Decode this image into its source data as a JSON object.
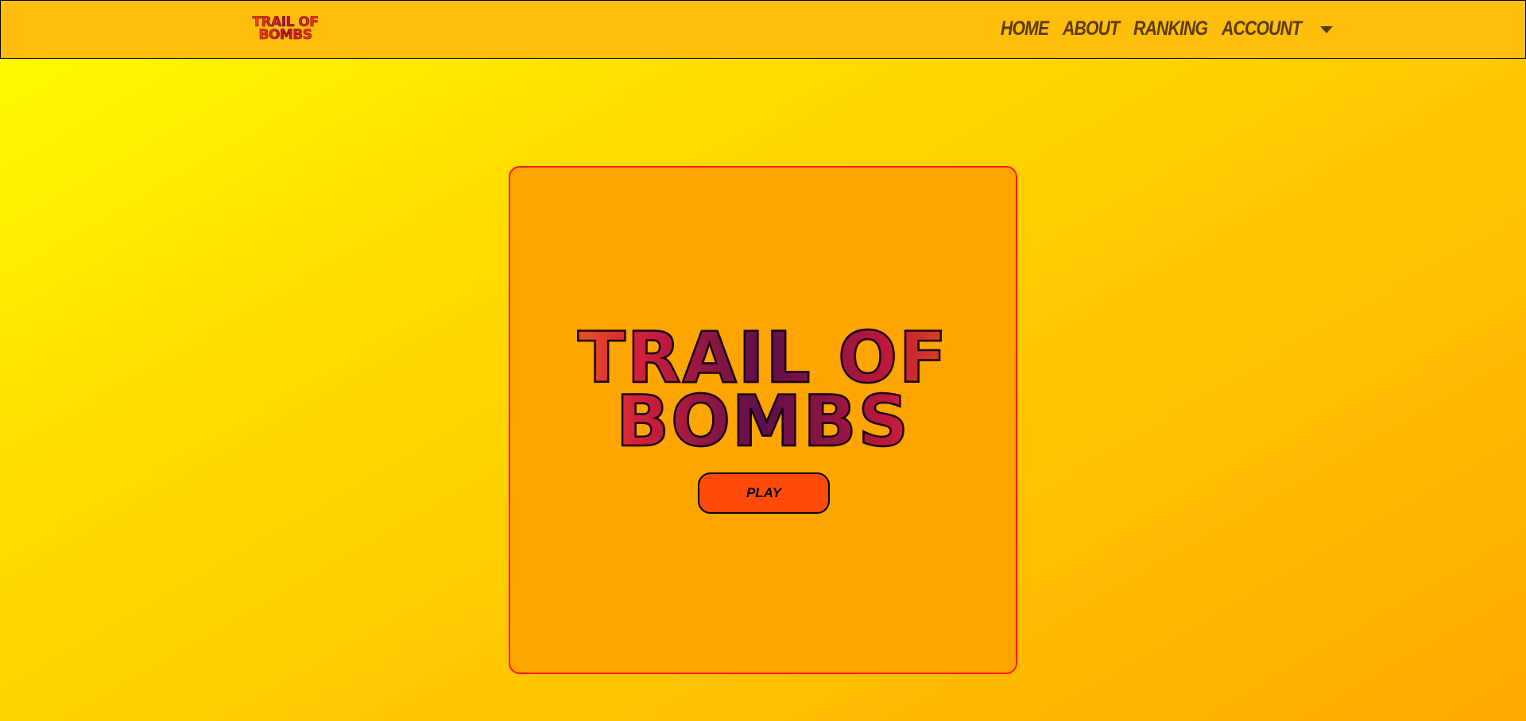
{
  "navbar": {
    "brand": {
      "line1": "TRAIL OF",
      "line2": "BOMBS"
    },
    "links": {
      "home": "HOME",
      "about": "ABOUT",
      "ranking": "RANKING",
      "account": "ACCOUNT"
    }
  },
  "main": {
    "title": {
      "line1": "TRAIL OF",
      "line2": "BOMBS"
    },
    "play_label": "PLAY"
  },
  "colors": {
    "background": "#ffd400",
    "navbar": "#ffbe0b",
    "card": "#ffa500",
    "card_border": "#ff1a1a",
    "play_button": "#ff4a0a",
    "nav_text": "#5a3a00"
  }
}
